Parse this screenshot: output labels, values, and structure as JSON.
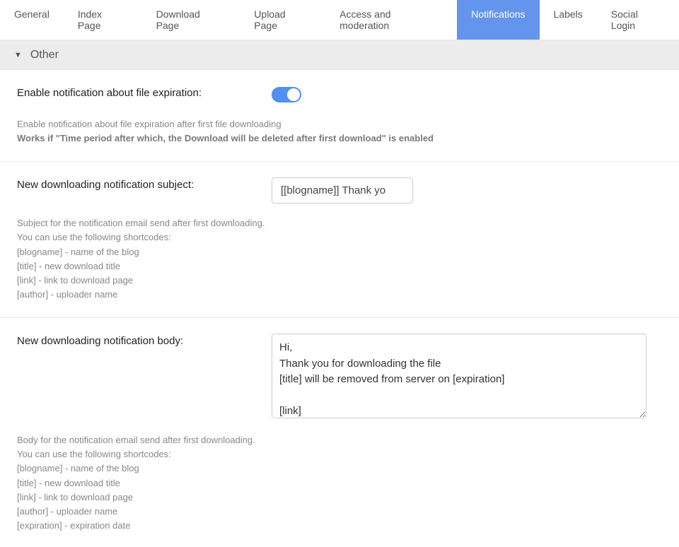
{
  "tabs": [
    {
      "label": "General",
      "active": false
    },
    {
      "label": "Index Page",
      "active": false
    },
    {
      "label": "Download Page",
      "active": false
    },
    {
      "label": "Upload Page",
      "active": false
    },
    {
      "label": "Access and moderation",
      "active": false
    },
    {
      "label": "Notifications",
      "active": true
    },
    {
      "label": "Labels",
      "active": false
    },
    {
      "label": "Social Login",
      "active": false
    }
  ],
  "section": {
    "title": "Other"
  },
  "fields": {
    "enable_expiration": {
      "label": "Enable notification about file expiration:",
      "value": true,
      "help1": "Enable notification about file expiration after first file downloading",
      "help2": "Works if \"Time period after which, the Download will be deleted after first download\" is enabled"
    },
    "subject": {
      "label": "New downloading notification subject:",
      "value": "[[blogname]] Thank yo",
      "help_intro": "Subject for the notification email send after first downloading.",
      "help_shortcodes_intro": "You can use the following shortcodes:",
      "shortcodes": [
        "[blogname] - name of the blog",
        "[title] - new download title",
        "[link] - link to download page",
        "[author] - uploader name"
      ]
    },
    "body": {
      "label": "New downloading notification body:",
      "value": "Hi,\nThank you for downloading the file\n[title] will be removed from server on [expiration]\n\n[link]",
      "help_intro": "Body for the notification email send after first downloading.",
      "help_shortcodes_intro": "You can use the following shortcodes:",
      "shortcodes": [
        "[blogname] - name of the blog",
        "[title] - new download title",
        "[link] - link to download page",
        "[author] - uploader name",
        "[expiration] - expiration date"
      ]
    }
  }
}
